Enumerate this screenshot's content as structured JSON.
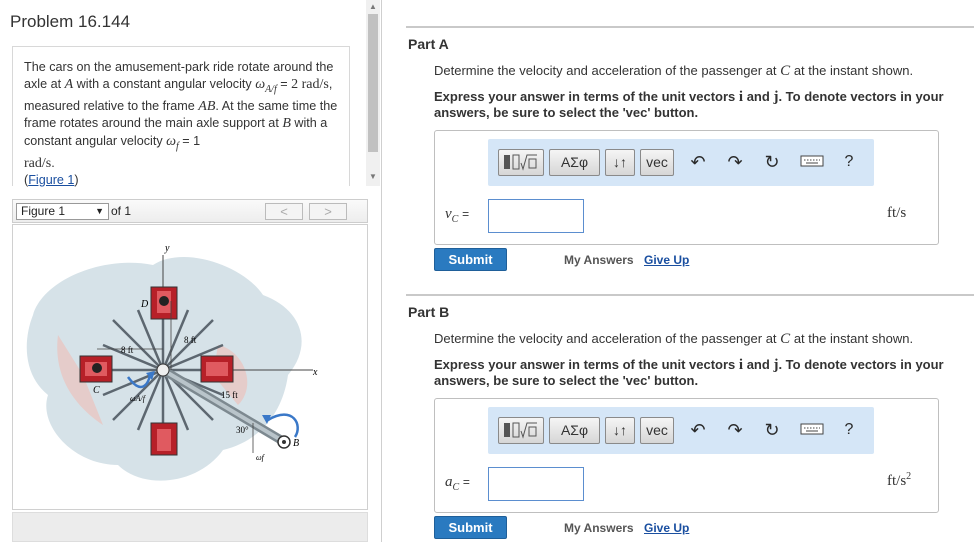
{
  "problem": {
    "title": "Problem 16.144",
    "text_1": "The cars on the amusement-park ride rotate around the axle at",
    "var_A": "A",
    "text_2": "with a constant angular velocity",
    "omega_af": "ω",
    "omega_af_sub": "A/f",
    "text_eq": "=",
    "value_2": "2",
    "unit_rad": "rad/s",
    "text_3": ", measured relative to the frame",
    "var_AB": "AB",
    "text_4": ". At the same time the frame rotates around the main axle support at",
    "var_B": "B",
    "text_5": "with a constant angular velocity",
    "omega_f": "ω",
    "omega_f_sub": "f",
    "value_1": "= 1",
    "text_6": ".",
    "figure_link": "Figure 1",
    "figure_link_open": "(",
    "figure_link_close": ")"
  },
  "figure_nav": {
    "select_value": "Figure 1",
    "of_label": "of 1",
    "prev": "<",
    "next": ">"
  },
  "figure_labels": {
    "y": "y",
    "x": "x",
    "D": "D",
    "C": "C",
    "A": "A",
    "B": "B",
    "dim_8ft_a": "8 ft",
    "dim_8ft_b": "8 ft",
    "dim_15ft": "15 ft",
    "angle": "30°",
    "omega_af": "ωA/f",
    "omega_f": "ωf"
  },
  "colors": {
    "submit": "#2a7ac0",
    "toolbar_bg": "#d5e6f7",
    "link": "#1a4fa0",
    "car_red": "#b72028"
  },
  "part_a": {
    "title": "Part A",
    "question_pre": "Determine the velocity and acceleration of the passenger at",
    "question_var": "C",
    "question_post": "at the instant shown.",
    "instructions_1": "Express your answer in terms of the unit vectors",
    "vec_i": "i",
    "and": "and",
    "vec_j": "j",
    "instructions_2": ". To denote vectors in your answers, be sure to select the 'vec' button.",
    "var_label": "vC",
    "var_main": "v",
    "var_sub": "C",
    "eq": "=",
    "input_value": "",
    "unit": "ft/s",
    "submit": "Submit",
    "my_answers": "My Answers",
    "give_up": "Give Up"
  },
  "part_b": {
    "title": "Part B",
    "question_pre": "Determine the velocity and acceleration of the passenger at",
    "question_var": "C",
    "question_post": "at the instant shown.",
    "instructions_1": "Express your answer in terms of the unit vectors",
    "vec_i": "i",
    "and": "and",
    "vec_j": "j",
    "instructions_2": ". To denote vectors in your answers, be sure to select the 'vec' button.",
    "var_main": "a",
    "var_sub": "C",
    "eq": "=",
    "input_value": "",
    "unit": "ft/s",
    "unit_exp": "2",
    "submit": "Submit",
    "my_answers": "My Answers",
    "give_up": "Give Up"
  },
  "toolbar": {
    "templates_icon": "template-icon",
    "greek": "ΑΣφ",
    "updown": "↓↑",
    "vec": "vec",
    "undo": "undo-icon",
    "redo": "redo-icon",
    "reset": "reset-icon",
    "keyboard": "keyboard-icon",
    "help": "?"
  }
}
